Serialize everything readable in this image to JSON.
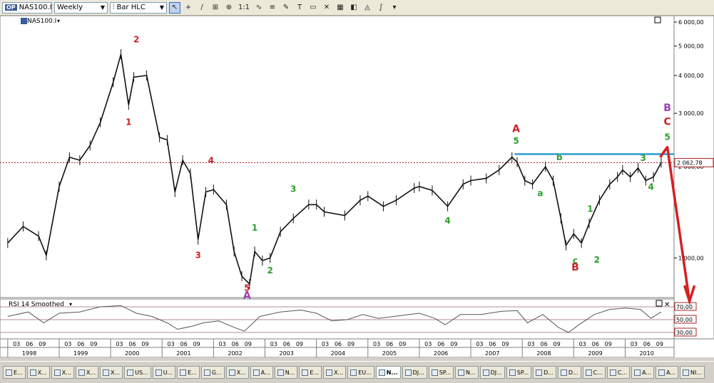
{
  "toolbar": {
    "symbol_badge": "OP",
    "symbol_value": "NAS100.I",
    "period_value": "Weekly",
    "charttype_value": "Bar HLC",
    "zoom_label": "1:1"
  },
  "chart_data": {
    "type": "line",
    "symbol_label": "NAS100.I",
    "scale": "log",
    "ylim": [
      740,
      6300
    ],
    "xlim": [
      1997.85,
      2010.95
    ],
    "y_ticks": [
      {
        "value": 6000,
        "label": "6 000,00"
      },
      {
        "value": 5000,
        "label": "5 000,00"
      },
      {
        "value": 4000,
        "label": "4 000,00"
      },
      {
        "value": 3000,
        "label": "3 000,00"
      },
      {
        "value": 2000,
        "label": "2 000,00"
      },
      {
        "value": 1000,
        "label": "1 000,00"
      }
    ],
    "last_price": {
      "value": 2062.78,
      "label": "2 062,78"
    },
    "series": [
      {
        "points": [
          [
            1998.0,
            1120
          ],
          [
            1998.3,
            1270
          ],
          [
            1998.6,
            1180
          ],
          [
            1998.75,
            1020
          ],
          [
            1999.0,
            1720
          ],
          [
            1999.2,
            2150
          ],
          [
            1999.4,
            2100
          ],
          [
            1999.6,
            2350
          ],
          [
            1999.8,
            2800
          ],
          [
            2000.05,
            3800
          ],
          [
            2000.2,
            4700
          ],
          [
            2000.35,
            3200
          ],
          [
            2000.45,
            3950
          ],
          [
            2000.7,
            4000
          ],
          [
            2000.95,
            2500
          ],
          [
            2001.1,
            2450
          ],
          [
            2001.25,
            1650
          ],
          [
            2001.4,
            2100
          ],
          [
            2001.55,
            1900
          ],
          [
            2001.7,
            1150
          ],
          [
            2001.85,
            1650
          ],
          [
            2002.0,
            1680
          ],
          [
            2002.25,
            1500
          ],
          [
            2002.4,
            1050
          ],
          [
            2002.55,
            870
          ],
          [
            2002.7,
            820
          ],
          [
            2002.8,
            1050
          ],
          [
            2002.95,
            980
          ],
          [
            2003.1,
            1000
          ],
          [
            2003.3,
            1220
          ],
          [
            2003.55,
            1350
          ],
          [
            2003.85,
            1500
          ],
          [
            2004.0,
            1500
          ],
          [
            2004.15,
            1420
          ],
          [
            2004.55,
            1380
          ],
          [
            2004.85,
            1550
          ],
          [
            2005.0,
            1600
          ],
          [
            2005.3,
            1480
          ],
          [
            2005.55,
            1550
          ],
          [
            2005.9,
            1700
          ],
          [
            2006.0,
            1720
          ],
          [
            2006.25,
            1670
          ],
          [
            2006.55,
            1480
          ],
          [
            2006.85,
            1750
          ],
          [
            2007.0,
            1800
          ],
          [
            2007.3,
            1830
          ],
          [
            2007.55,
            1950
          ],
          [
            2007.8,
            2150
          ],
          [
            2007.9,
            2070
          ],
          [
            2008.05,
            1800
          ],
          [
            2008.2,
            1750
          ],
          [
            2008.45,
            2000
          ],
          [
            2008.6,
            1800
          ],
          [
            2008.75,
            1350
          ],
          [
            2008.85,
            1100
          ],
          [
            2009.0,
            1200
          ],
          [
            2009.15,
            1120
          ],
          [
            2009.3,
            1300
          ],
          [
            2009.5,
            1550
          ],
          [
            2009.7,
            1750
          ],
          [
            2009.85,
            1850
          ],
          [
            2009.95,
            1950
          ],
          [
            2010.1,
            1850
          ],
          [
            2010.25,
            1980
          ],
          [
            2010.4,
            1800
          ],
          [
            2010.55,
            1850
          ],
          [
            2010.7,
            2062
          ]
        ]
      }
    ],
    "resistance_level": 2200,
    "projection": [
      [
        2010.68,
        2150
      ],
      [
        2010.82,
        2320
      ],
      [
        2011.25,
        720
      ]
    ],
    "wave_labels": [
      {
        "text": "1",
        "x": 2000.35,
        "y": 2750,
        "color": "red"
      },
      {
        "text": "2",
        "x": 2000.5,
        "y": 5150,
        "color": "red"
      },
      {
        "text": "3",
        "x": 2001.7,
        "y": 1000,
        "color": "red"
      },
      {
        "text": "4",
        "x": 2001.95,
        "y": 2050,
        "color": "red"
      },
      {
        "text": "5",
        "x": 2002.65,
        "y": 780,
        "color": "red"
      },
      {
        "text": "A",
        "x": 2002.65,
        "y": 735,
        "color": "purple"
      },
      {
        "text": "1",
        "x": 2002.8,
        "y": 1230,
        "color": "green"
      },
      {
        "text": "2",
        "x": 2003.1,
        "y": 890,
        "color": "green"
      },
      {
        "text": "3",
        "x": 2003.55,
        "y": 1650,
        "color": "green"
      },
      {
        "text": "4",
        "x": 2006.55,
        "y": 1300,
        "color": "green"
      },
      {
        "text": "A",
        "x": 2007.88,
        "y": 2600,
        "color": "red"
      },
      {
        "text": "5",
        "x": 2007.88,
        "y": 2380,
        "color": "green"
      },
      {
        "text": "a",
        "x": 2008.35,
        "y": 1600,
        "color": "green"
      },
      {
        "text": "b",
        "x": 2008.72,
        "y": 2100,
        "color": "green"
      },
      {
        "text": "c",
        "x": 2009.03,
        "y": 960,
        "color": "green"
      },
      {
        "text": "B",
        "x": 2009.03,
        "y": 910,
        "color": "red"
      },
      {
        "text": "1",
        "x": 2009.32,
        "y": 1420,
        "color": "green"
      },
      {
        "text": "2",
        "x": 2009.45,
        "y": 965,
        "color": "green"
      },
      {
        "text": "3",
        "x": 2010.35,
        "y": 2090,
        "color": "green"
      },
      {
        "text": "4",
        "x": 2010.5,
        "y": 1680,
        "color": "green"
      },
      {
        "text": "5",
        "x": 2010.82,
        "y": 2450,
        "color": "green"
      },
      {
        "text": "C",
        "x": 2010.82,
        "y": 2750,
        "color": "red"
      },
      {
        "text": "B",
        "x": 2010.82,
        "y": 3050,
        "color": "purple"
      }
    ]
  },
  "rsi": {
    "title": "RSI 14 Smoothed",
    "levels": [
      {
        "value": 70,
        "label": "70,00"
      },
      {
        "value": 50,
        "label": "50,00"
      },
      {
        "value": 30,
        "label": "30,00"
      }
    ],
    "points": [
      [
        1998.0,
        55
      ],
      [
        1998.4,
        62
      ],
      [
        1998.7,
        45
      ],
      [
        1999.0,
        60
      ],
      [
        1999.4,
        62
      ],
      [
        1999.8,
        70
      ],
      [
        2000.2,
        72
      ],
      [
        2000.5,
        60
      ],
      [
        2000.8,
        55
      ],
      [
        2001.1,
        45
      ],
      [
        2001.3,
        35
      ],
      [
        2001.6,
        40
      ],
      [
        2001.8,
        45
      ],
      [
        2002.1,
        48
      ],
      [
        2002.4,
        38
      ],
      [
        2002.6,
        32
      ],
      [
        2002.9,
        55
      ],
      [
        2003.3,
        62
      ],
      [
        2003.7,
        65
      ],
      [
        2004.0,
        60
      ],
      [
        2004.3,
        48
      ],
      [
        2004.6,
        50
      ],
      [
        2004.9,
        58
      ],
      [
        2005.2,
        52
      ],
      [
        2005.6,
        56
      ],
      [
        2006.0,
        60
      ],
      [
        2006.3,
        52
      ],
      [
        2006.5,
        42
      ],
      [
        2006.8,
        58
      ],
      [
        2007.2,
        58
      ],
      [
        2007.6,
        63
      ],
      [
        2007.9,
        64
      ],
      [
        2008.1,
        45
      ],
      [
        2008.4,
        58
      ],
      [
        2008.7,
        38
      ],
      [
        2008.9,
        30
      ],
      [
        2009.1,
        42
      ],
      [
        2009.4,
        58
      ],
      [
        2009.7,
        66
      ],
      [
        2010.0,
        68
      ],
      [
        2010.3,
        66
      ],
      [
        2010.5,
        52
      ],
      [
        2010.7,
        62
      ]
    ]
  },
  "time_axis": {
    "months": [
      "03",
      "06",
      "09"
    ],
    "years": [
      "1998",
      "1999",
      "2000",
      "2001",
      "2002",
      "2003",
      "2004",
      "2005",
      "2006",
      "2007",
      "2008",
      "2009",
      "2010"
    ]
  },
  "tabs": [
    "E...",
    "X...",
    "X...",
    "X...",
    "X...",
    "US...",
    "U...",
    "E...",
    "G...",
    "X...",
    "A...",
    "N...",
    "E...",
    "X...",
    "EU...",
    "N...",
    "DJ...",
    "SP...",
    "N...",
    "DJ...",
    "SP...",
    "D...",
    "D...",
    "C...",
    "C...",
    "A...",
    "A...",
    "NI..."
  ],
  "active_tab_index": 15
}
